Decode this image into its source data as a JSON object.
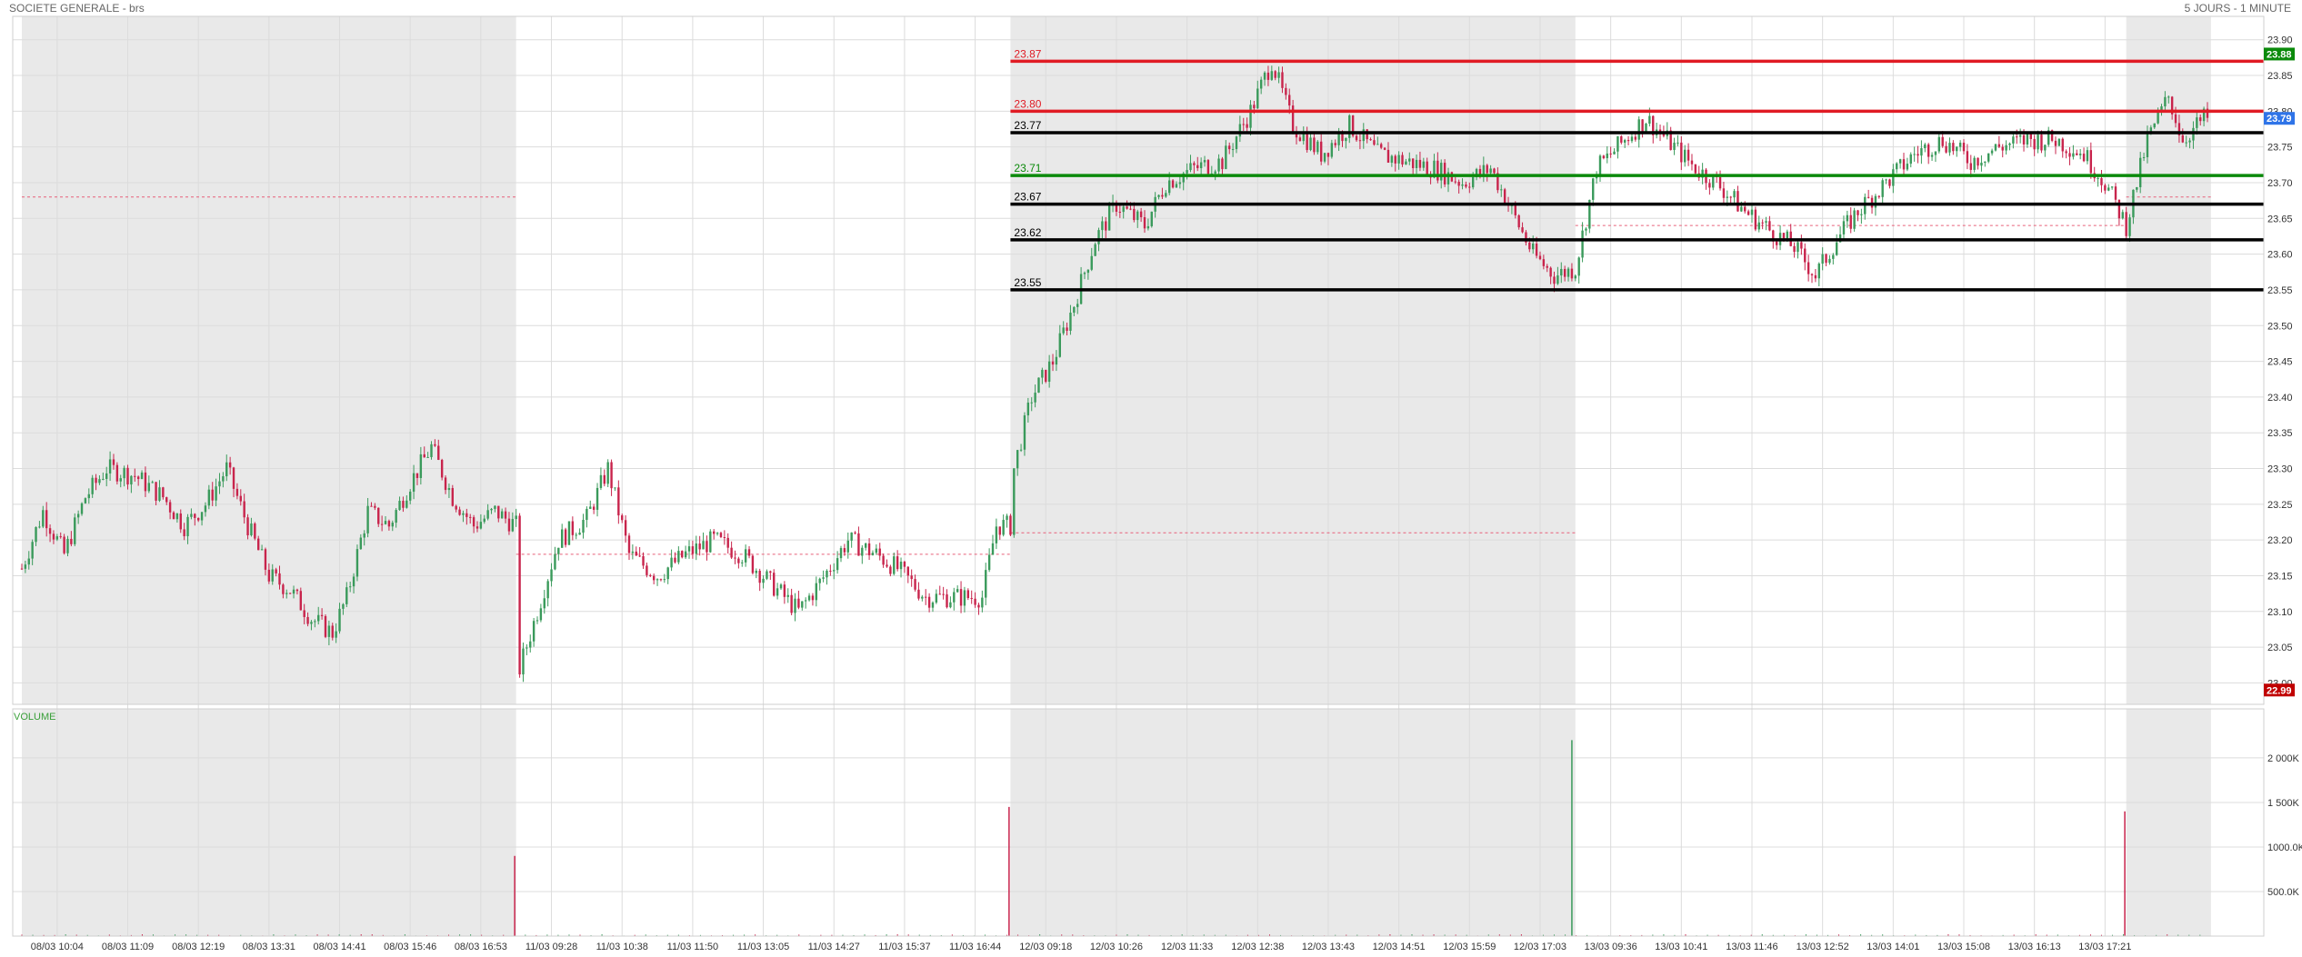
{
  "header": {
    "title": "SOCIETE GENERALE - brs",
    "period": "5 JOURS - 1 MINUTE"
  },
  "colors": {
    "up": "#3a9a5b",
    "down": "#c8244c",
    "shade": "#e9e9e9",
    "grid": "#dcdcdc",
    "resistance": "#e01b24",
    "support": "#000000",
    "pivot": "#0b8a0b",
    "badge_high": "#0b8a0b",
    "badge_last": "#2f74e8",
    "badge_low": "#c00000",
    "volume_label": "#3aa03a"
  },
  "chart_data": [
    {
      "type": "candlestick",
      "title": "SOCIETE GENERALE - brs",
      "ylim": [
        22.97,
        23.92
      ],
      "y_ticks": [
        23.9,
        23.85,
        23.8,
        23.75,
        23.7,
        23.65,
        23.6,
        23.55,
        23.5,
        23.45,
        23.4,
        23.35,
        23.3,
        23.25,
        23.2,
        23.15,
        23.1,
        23.05,
        23.0
      ],
      "y_tick_labels": [
        "23.90",
        "23.85",
        "23.80",
        "23.75",
        "23.70",
        "23.65",
        "23.60",
        "23.55",
        "23.50",
        "23.45",
        "23.40",
        "23.35",
        "23.30",
        "23.25",
        "23.20",
        "23.15",
        "23.10",
        "23.05",
        "23.00"
      ],
      "x_ticks": [
        "08/03 10:04",
        "08/03 11:09",
        "08/03 12:19",
        "08/03 13:31",
        "08/03 14:41",
        "08/03 15:46",
        "08/03 16:53",
        "11/03 09:28",
        "11/03 10:38",
        "11/03 11:50",
        "11/03 13:05",
        "11/03 14:27",
        "11/03 15:37",
        "11/03 16:44",
        "12/03 09:18",
        "12/03 10:26",
        "12/03 11:33",
        "12/03 12:38",
        "12/03 13:43",
        "12/03 14:51",
        "12/03 15:59",
        "12/03 17:03",
        "13/03 09:36",
        "13/03 10:41",
        "13/03 11:46",
        "13/03 12:52",
        "13/03 14:01",
        "13/03 15:08",
        "13/03 16:13",
        "13/03 17:21"
      ],
      "shaded_sessions": [
        [
          0,
          7
        ],
        [
          14,
          22
        ],
        [
          29.8,
          31
        ]
      ],
      "price_path": [
        [
          0,
          23.16
        ],
        [
          0.3,
          23.24
        ],
        [
          0.6,
          23.18
        ],
        [
          0.9,
          23.26
        ],
        [
          1.2,
          23.3
        ],
        [
          1.6,
          23.29
        ],
        [
          2.0,
          23.26
        ],
        [
          2.3,
          23.22
        ],
        [
          2.6,
          23.25
        ],
        [
          2.9,
          23.3
        ],
        [
          3.2,
          23.22
        ],
        [
          3.5,
          23.15
        ],
        [
          3.8,
          23.13
        ],
        [
          4.1,
          23.09
        ],
        [
          4.4,
          23.07
        ],
        [
          4.6,
          23.12
        ],
        [
          4.9,
          23.24
        ],
        [
          5.2,
          23.22
        ],
        [
          5.5,
          23.28
        ],
        [
          5.8,
          23.33
        ],
        [
          6.1,
          23.26
        ],
        [
          6.4,
          23.22
        ],
        [
          6.7,
          23.24
        ],
        [
          7.0,
          23.22
        ],
        [
          7.05,
          23.02
        ],
        [
          7.3,
          23.1
        ],
        [
          7.6,
          23.2
        ],
        [
          8.0,
          23.23
        ],
        [
          8.3,
          23.3
        ],
        [
          8.6,
          23.18
        ],
        [
          9.0,
          23.15
        ],
        [
          9.4,
          23.18
        ],
        [
          9.8,
          23.2
        ],
        [
          10.2,
          23.18
        ],
        [
          10.6,
          23.14
        ],
        [
          11.0,
          23.1
        ],
        [
          11.3,
          23.14
        ],
        [
          11.7,
          23.2
        ],
        [
          12.1,
          23.18
        ],
        [
          12.4,
          23.16
        ],
        [
          12.8,
          23.12
        ],
        [
          13.2,
          23.12
        ],
        [
          13.6,
          23.12
        ],
        [
          13.8,
          23.22
        ],
        [
          14.0,
          23.22
        ],
        [
          14.05,
          23.3
        ],
        [
          14.3,
          23.4
        ],
        [
          14.6,
          23.45
        ],
        [
          14.9,
          23.53
        ],
        [
          15.2,
          23.62
        ],
        [
          15.5,
          23.67
        ],
        [
          15.9,
          23.64
        ],
        [
          16.2,
          23.7
        ],
        [
          16.6,
          23.72
        ],
        [
          17.0,
          23.73
        ],
        [
          17.4,
          23.8
        ],
        [
          17.7,
          23.87
        ],
        [
          18.0,
          23.78
        ],
        [
          18.4,
          23.74
        ],
        [
          18.8,
          23.78
        ],
        [
          19.2,
          23.74
        ],
        [
          19.6,
          23.73
        ],
        [
          20.0,
          23.72
        ],
        [
          20.4,
          23.7
        ],
        [
          20.8,
          23.72
        ],
        [
          21.1,
          23.66
        ],
        [
          21.4,
          23.6
        ],
        [
          21.7,
          23.57
        ],
        [
          22.0,
          23.58
        ],
        [
          22.3,
          23.72
        ],
        [
          22.7,
          23.76
        ],
        [
          23.0,
          23.79
        ],
        [
          23.4,
          23.75
        ],
        [
          23.7,
          23.72
        ],
        [
          24.0,
          23.7
        ],
        [
          24.4,
          23.66
        ],
        [
          24.8,
          23.63
        ],
        [
          25.1,
          23.61
        ],
        [
          25.4,
          23.57
        ],
        [
          25.7,
          23.62
        ],
        [
          26.0,
          23.66
        ],
        [
          26.4,
          23.7
        ],
        [
          26.8,
          23.74
        ],
        [
          27.2,
          23.76
        ],
        [
          27.6,
          23.73
        ],
        [
          28.0,
          23.75
        ],
        [
          28.4,
          23.76
        ],
        [
          28.8,
          23.76
        ],
        [
          29.2,
          23.74
        ],
        [
          29.5,
          23.7
        ],
        [
          29.8,
          23.64
        ],
        [
          30.1,
          23.76
        ],
        [
          30.4,
          23.82
        ],
        [
          30.6,
          23.76
        ],
        [
          30.9,
          23.79
        ]
      ],
      "previous_close_refs": [
        {
          "x_from": 0,
          "x_to": 7,
          "value": 23.68
        },
        {
          "x_from": 7,
          "x_to": 14,
          "value": 23.18
        },
        {
          "x_from": 14,
          "x_to": 22,
          "value": 23.21
        },
        {
          "x_from": 22,
          "x_to": 29.8,
          "value": 23.64
        },
        {
          "x_from": 29.8,
          "x_to": 31,
          "value": 23.68
        }
      ],
      "levels": [
        {
          "label": "23.87",
          "value": 23.87,
          "kind": "resistance"
        },
        {
          "label": "23.80",
          "value": 23.8,
          "kind": "resistance"
        },
        {
          "label": "23.77",
          "value": 23.77,
          "kind": "support"
        },
        {
          "label": "23.71",
          "value": 23.71,
          "kind": "pivot"
        },
        {
          "label": "23.67",
          "value": 23.67,
          "kind": "support"
        },
        {
          "label": "23.62",
          "value": 23.62,
          "kind": "support"
        },
        {
          "label": "23.55",
          "value": 23.55,
          "kind": "support"
        }
      ],
      "badges": [
        {
          "label": "23.88",
          "value": 23.88,
          "kind": "high"
        },
        {
          "label": "23.79",
          "value": 23.79,
          "kind": "last"
        },
        {
          "label": "22.99",
          "value": 22.99,
          "kind": "low"
        }
      ]
    },
    {
      "type": "bar",
      "title": "VOLUME",
      "ylim": [
        0,
        2550000
      ],
      "y_ticks": [
        2000000,
        1500000,
        1000000,
        500000
      ],
      "y_tick_labels": [
        "2 000K",
        "1 500K",
        "1000.0K",
        "500.0K"
      ],
      "spikes": [
        {
          "x": 6.98,
          "value": 900000,
          "dir": "down"
        },
        {
          "x": 13.98,
          "value": 1450000,
          "dir": "down"
        },
        {
          "x": 21.95,
          "value": 2200000,
          "dir": "up"
        },
        {
          "x": 29.78,
          "value": 1400000,
          "dir": "down"
        }
      ],
      "baseline_volume": 15000
    }
  ]
}
